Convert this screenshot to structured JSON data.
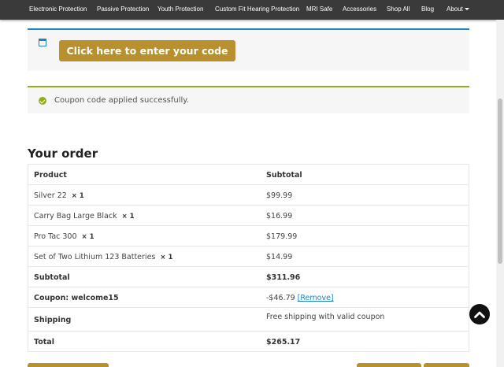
{
  "nav": {
    "items": [
      {
        "label": "Electronic Protection"
      },
      {
        "label": "Passive Protection"
      },
      {
        "label": "Youth Protection"
      },
      {
        "label": "Custom Fit Hearing Protection"
      },
      {
        "label": "MRI Safe"
      },
      {
        "label": "Accessories"
      },
      {
        "label": "Shop All"
      },
      {
        "label": "Blog"
      },
      {
        "label": "About"
      }
    ]
  },
  "coupon": {
    "button_label": "Click here to enter your code",
    "icon": "window-icon",
    "accent": "#1e85be",
    "button_color": "#b8902d"
  },
  "message": {
    "text": "Coupon code applied successfully.",
    "icon": "check-circle-icon",
    "color": "#8fae1b"
  },
  "order": {
    "title": "Your order",
    "header": {
      "product": "Product",
      "subtotal": "Subtotal"
    },
    "items": [
      {
        "name": "Silver 22",
        "qty": "× 1",
        "price": "$99.99"
      },
      {
        "name": "Carry Bag Large Black",
        "qty": "× 1",
        "price": "$16.99"
      },
      {
        "name": "Pro Tac 300",
        "qty": "× 1",
        "price": "$179.99"
      },
      {
        "name": "Set of Two Lithium 123 Batteries",
        "qty": "× 1",
        "price": "$14.99"
      }
    ],
    "subtotal": {
      "label": "Subtotal",
      "value": "$311.96"
    },
    "coupon_line": {
      "label": "Coupon: welcome15",
      "value": "-$46.79",
      "remove": "[Remove]"
    },
    "shipping": {
      "label": "Shipping",
      "value": "Free shipping with valid coupon"
    },
    "total": {
      "label": "Total",
      "value": "$265.17"
    }
  },
  "scroll_top": {
    "icon": "chevron-up-icon"
  }
}
